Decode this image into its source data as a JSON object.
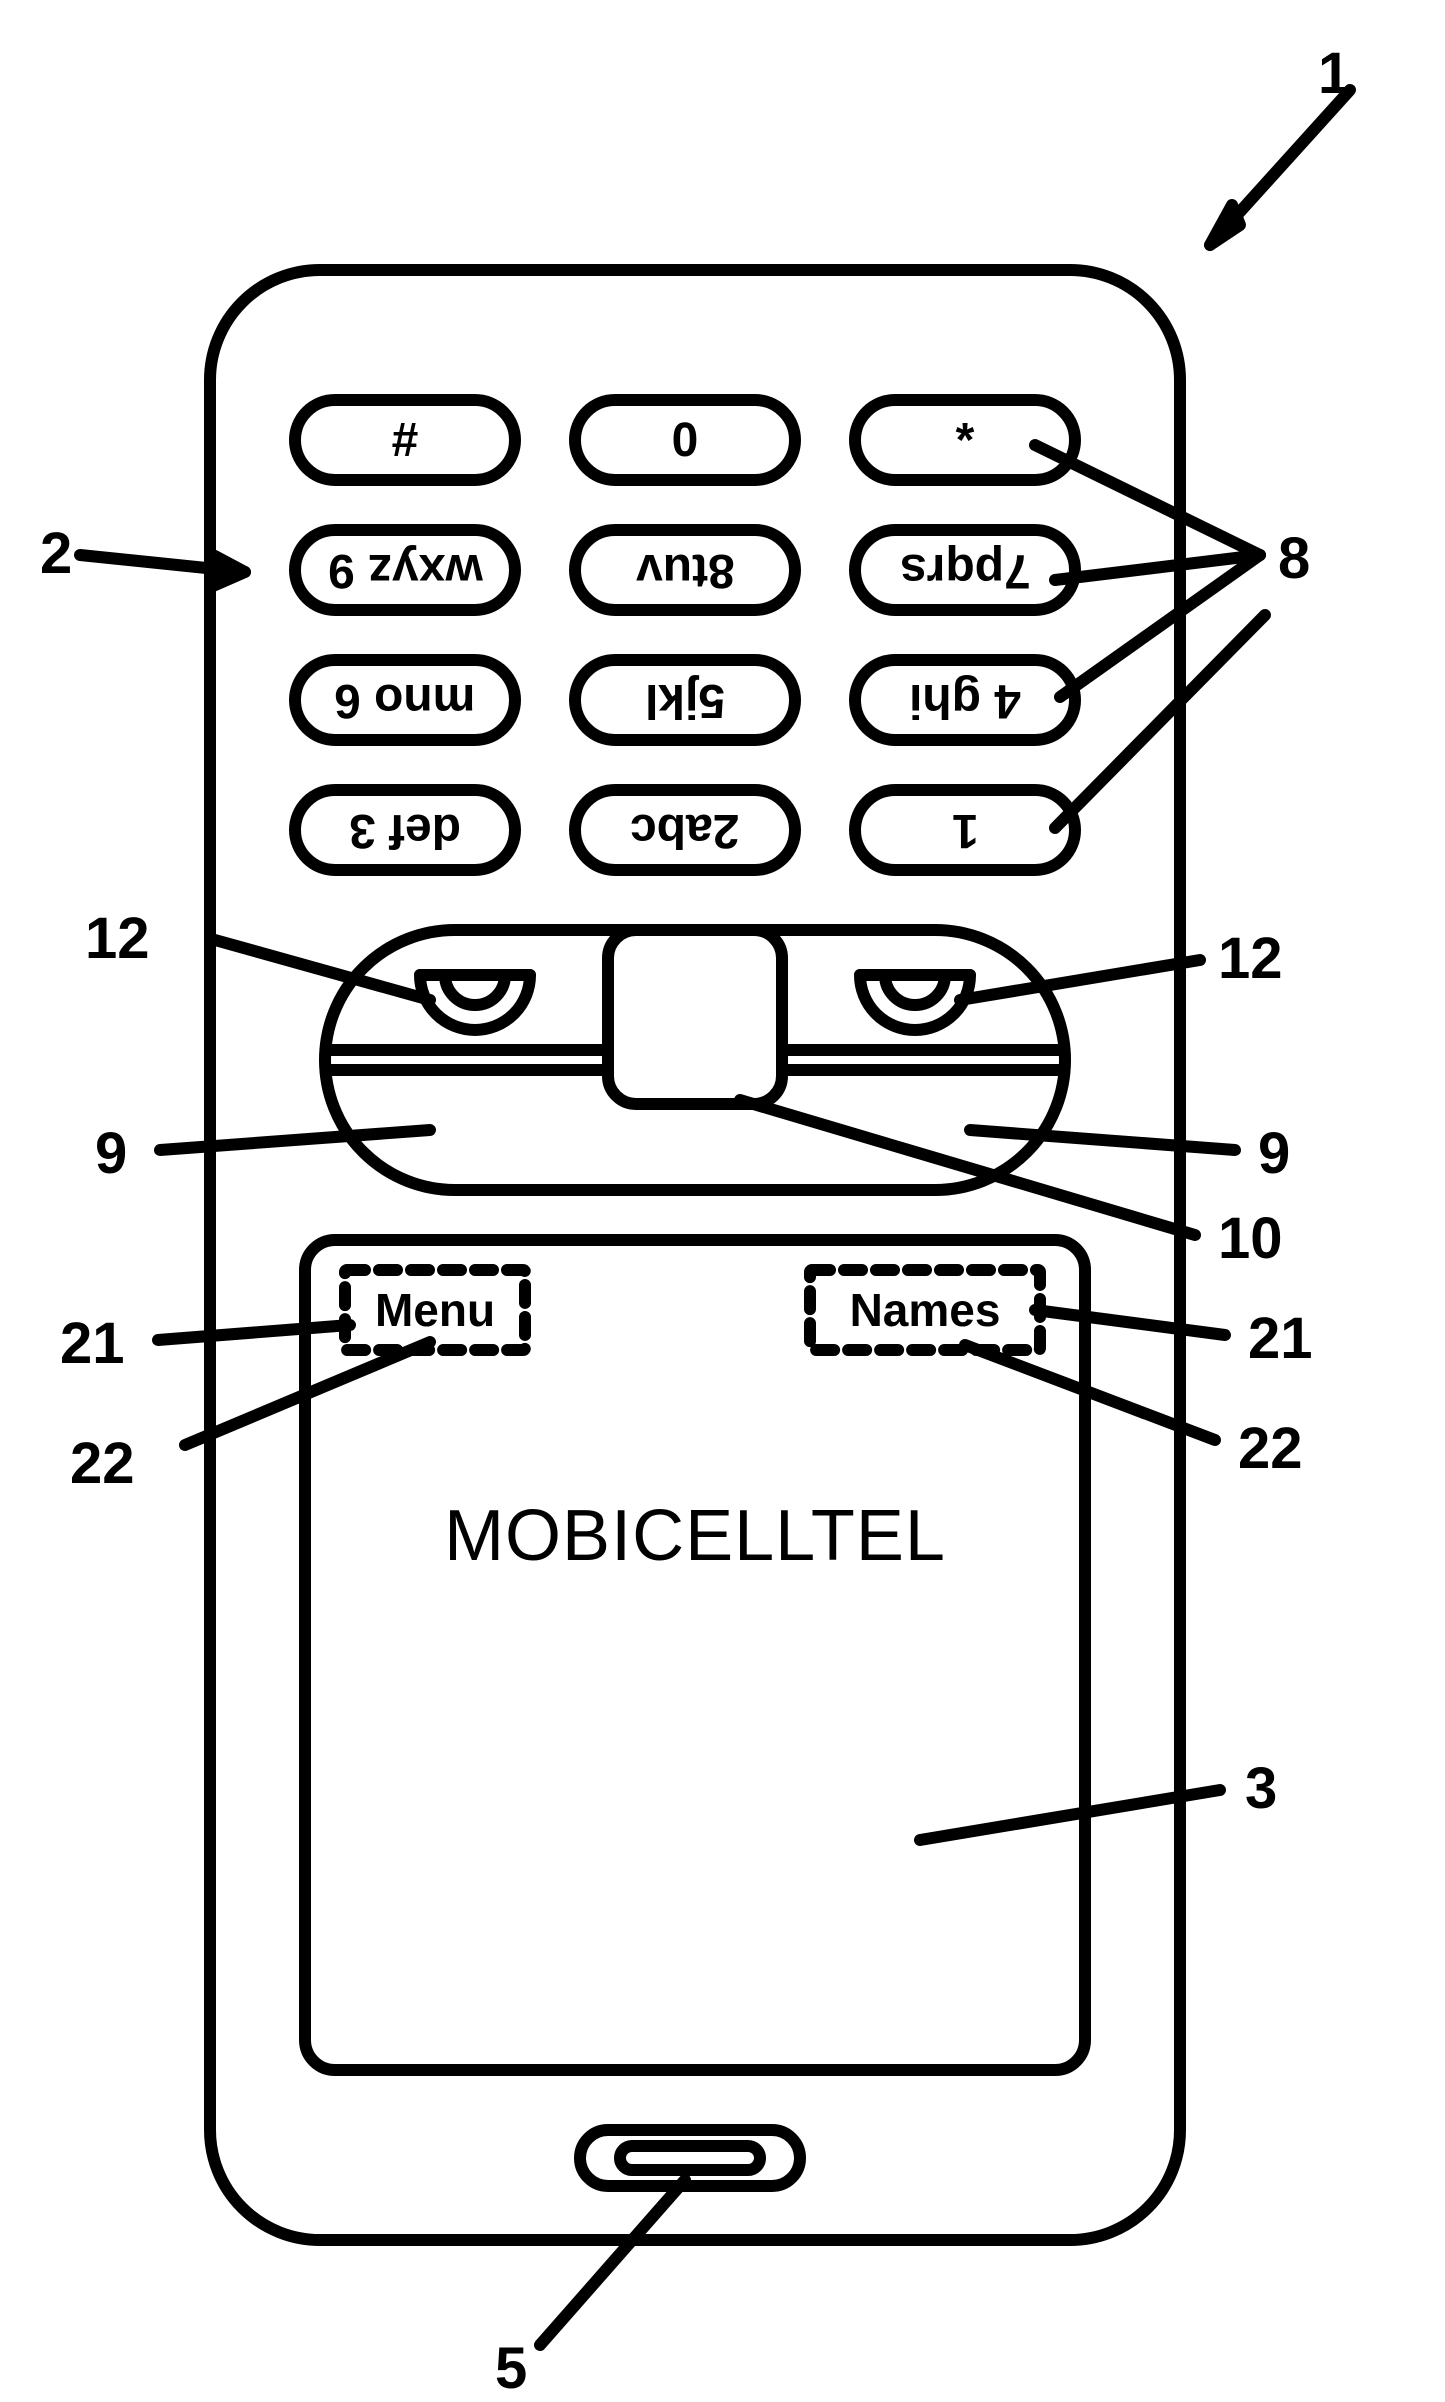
{
  "refs": {
    "r1": "1",
    "r2": "2",
    "r3": "3",
    "r5": "5",
    "r8": "8",
    "r9L": "9",
    "r9R": "9",
    "r10": "10",
    "r12L": "12",
    "r12R": "12",
    "r21L": "21",
    "r21R": "21",
    "r22L": "22",
    "r22R": "22"
  },
  "keypad": {
    "row1": {
      "c1": "#",
      "c2": "0",
      "c3": "*"
    },
    "row2": {
      "c1": "wxyz 9",
      "c2": "8tuv",
      "c3": "7pqrs"
    },
    "row3": {
      "c1": "mno 6",
      "c2": "5jkl",
      "c3": "4 ghi"
    },
    "row4": {
      "c1": "def 3",
      "c2": "2abc",
      "c3": "1"
    }
  },
  "softkeys": {
    "left": "Menu",
    "right": "Names"
  },
  "screen": {
    "brand": "MOBICELLTEL"
  }
}
